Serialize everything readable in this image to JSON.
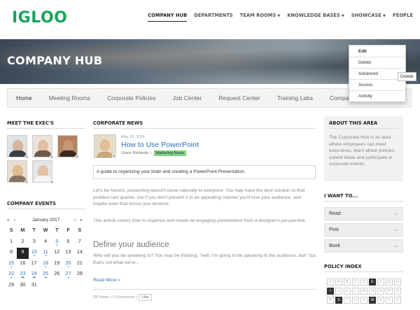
{
  "app": {
    "logo": "IGLOO"
  },
  "nav": {
    "company_hub": "COMPANY HUB",
    "departments": "DEPARTMENTS",
    "team_rooms": "TEAM ROOMS",
    "knowledge_bases": "KNOWLEDGE BASES",
    "showcase": "SHOWCASE",
    "people": "PEOPLE"
  },
  "banner": {
    "title": "COMPANY HUB"
  },
  "menu": {
    "edit": "Edit",
    "delete": "Delete",
    "advanced": "Advanced",
    "access": "Access",
    "activity": "Activity",
    "tooltip": "Delete"
  },
  "tabs": [
    "Home",
    "Meeting Rooms",
    "Corporate Policies",
    "Job Center",
    "Request Center",
    "Training Labs",
    "Company Directo"
  ],
  "execs": {
    "heading": "MEET THE EXEC'S"
  },
  "events": {
    "heading": "COMPANY EVENTS",
    "prev_year": "«",
    "prev_month": "‹",
    "month": "January 2017",
    "next_month": "›",
    "next_year": "»",
    "dow": [
      "S",
      "M",
      "T",
      "W",
      "T",
      "F",
      "S"
    ],
    "weeks": [
      [
        "1",
        "2",
        "3",
        "4",
        "5",
        "6",
        "7"
      ],
      [
        "8",
        "9",
        "10",
        "11",
        "12",
        "13",
        "14"
      ],
      [
        "15",
        "16",
        "17",
        "18",
        "19",
        "20",
        "21"
      ],
      [
        "22",
        "23",
        "24",
        "25",
        "26",
        "27",
        "28"
      ],
      [
        "29",
        "30",
        "31",
        "",
        "",
        "",
        ""
      ]
    ]
  },
  "news": {
    "heading": "CORPORATE NEWS",
    "date": "May 19, 2016",
    "title": "How to Use PowerPoint",
    "author": "Grace Richards –",
    "tag": "Marketing News",
    "summary": "A guide to organizing your brain and creating a PowerPoint Presentation.",
    "p1": "Let's be honest, presenting doesn't come naturally to everyone. You may have the best solution to that problem last quarter, but if you don't present it in an appealing manner you'll lose your audience, and maybe even that bonus you deserve.",
    "p2": "This article covers how to organize and create an engaging presentation from a designer's perspective.",
    "h2": "Define your audience",
    "p3": "Who will you be speaking to? You may be thinking, \"well, I'm going to be speaking to the audience, duh\" but that's not what we're...",
    "read_more": "Read More »",
    "views": "28 Views",
    "comments": "0 Comments",
    "like": "Like"
  },
  "about": {
    "heading": "ABOUT THIS AREA",
    "text": "The Corporate Hub is an area where employees can meet executives, learn about policies, submit ideas and participate in corporate events."
  },
  "want": {
    "heading": "I WANT TO...",
    "items": [
      "Read",
      "Post",
      "Book"
    ]
  },
  "policy": {
    "heading": "POLICY INDEX",
    "letters": [
      "#",
      "A",
      "B",
      "C",
      "D",
      "E",
      "F",
      "G",
      "H",
      "I",
      "J",
      "K",
      "L",
      "M",
      "N",
      "O",
      "P",
      "Q",
      "R",
      "S",
      "T",
      "U",
      "V",
      "W",
      "X",
      "Y",
      "Z"
    ],
    "active": [
      "E",
      "I",
      "S",
      "W"
    ]
  }
}
